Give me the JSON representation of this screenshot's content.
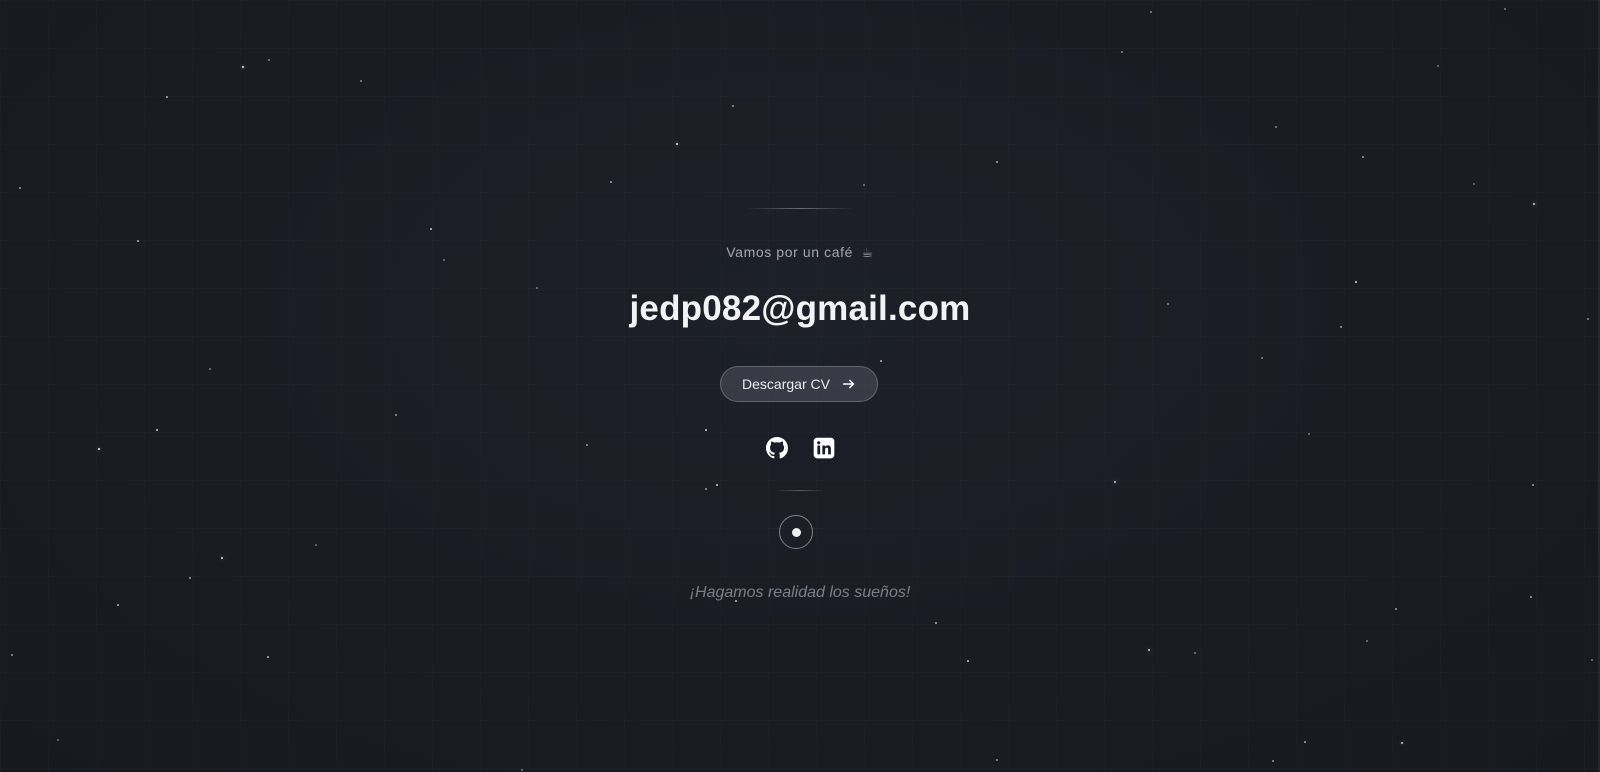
{
  "contact": {
    "tagline": "Vamos por un café",
    "tagline_icon": "coffee-cup-icon",
    "email": "jedp082@gmail.com"
  },
  "cv_button": {
    "label": "Descargar CV",
    "icon": "arrow-right-icon"
  },
  "socials": [
    {
      "name": "github",
      "icon": "github-icon"
    },
    {
      "name": "linkedin",
      "icon": "linkedin-icon"
    }
  ],
  "closing": {
    "text": "¡Hagamos realidad los sueños!"
  },
  "colors": {
    "background": "#1a1c24",
    "text_primary": "#f3f3f6",
    "text_muted": "#a3a6b0",
    "text_italic": "#7c7f8a"
  }
}
